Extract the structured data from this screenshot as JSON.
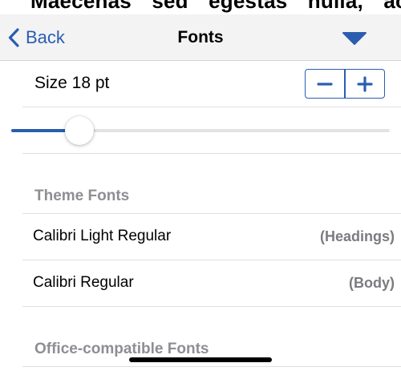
{
  "document": {
    "peek_text": "Maecenas sed egestas nulla, ac"
  },
  "navbar": {
    "back_label": "Back",
    "title": "Fonts",
    "accent_color": "#2a5db0"
  },
  "size": {
    "label": "Size 18 pt",
    "decrease_icon": "minus-icon",
    "increase_icon": "plus-icon",
    "slider_fraction": 0.18
  },
  "sections": [
    {
      "title": "Theme Fonts",
      "items": [
        {
          "name": "Calibri Light Regular",
          "role": "(Headings)"
        },
        {
          "name": "Calibri Regular",
          "role": "(Body)"
        }
      ]
    },
    {
      "title": "Office-compatible Fonts",
      "items": []
    }
  ]
}
